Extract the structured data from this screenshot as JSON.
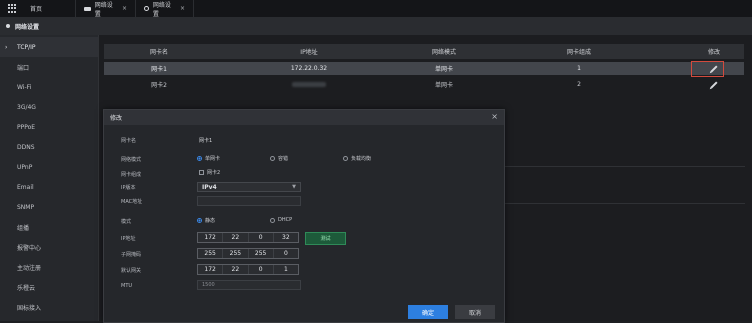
{
  "tabs": [
    {
      "label": "首页"
    },
    {
      "label": "网络设置",
      "icon": "camera-icon"
    },
    {
      "label": "网络设置",
      "icon": "gear-icon"
    }
  ],
  "tab_close": "×",
  "header": {
    "title": "网络设置"
  },
  "sidebar": {
    "items": [
      {
        "label": "TCP/IP",
        "active": true,
        "caret": "›"
      },
      {
        "label": "端口"
      },
      {
        "label": "Wi-Fi"
      },
      {
        "label": "3G/4G"
      },
      {
        "label": "PPPoE"
      },
      {
        "label": "DDNS"
      },
      {
        "label": "UPnP"
      },
      {
        "label": "Email"
      },
      {
        "label": "SNMP"
      },
      {
        "label": "组播"
      },
      {
        "label": "报警中心"
      },
      {
        "label": "主动注册"
      },
      {
        "label": "乐橙云"
      },
      {
        "label": "国标接入"
      }
    ]
  },
  "table": {
    "headers": [
      "网卡名",
      "IP地址",
      "网络模式",
      "网卡组成",
      "修改"
    ],
    "rows": [
      {
        "name": "网卡1",
        "ip": "172.22.0.32",
        "mode": "单网卡",
        "members": "1"
      },
      {
        "name": "网卡2",
        "ip": "",
        "mode": "单网卡",
        "members": "2"
      }
    ]
  },
  "dialog": {
    "title": "修改",
    "close": "×",
    "nic_name_label": "网卡名",
    "nic_name_value": "网卡1",
    "network_mode_label": "网络模式",
    "mode_options": [
      "单网卡",
      "容错",
      "负载均衡"
    ],
    "nic_member_label": "网卡组成",
    "nic_member_option": "网卡2",
    "ip_version_label": "IP版本",
    "ip_version_value": "IPv4",
    "mac_label": "MAC地址",
    "mode_label": "模式",
    "addr_mode_options": [
      "静态",
      "DHCP"
    ],
    "ip_label": "IP地址",
    "ip": [
      "172",
      "22",
      "0",
      "32"
    ],
    "test_button": "测试",
    "mask_label": "子网掩码",
    "mask": [
      "255",
      "255",
      "255",
      "0"
    ],
    "gateway_label": "默认网关",
    "gateway": [
      "172",
      "22",
      "0",
      "1"
    ],
    "mtu_label": "MTU",
    "mtu_placeholder": "1500",
    "ok_button": "确定",
    "cancel_button": "取消"
  },
  "colors": {
    "accent": "#2d7fe0",
    "highlight_border": "#d24a3d",
    "test_green": "#1d5a3a"
  }
}
